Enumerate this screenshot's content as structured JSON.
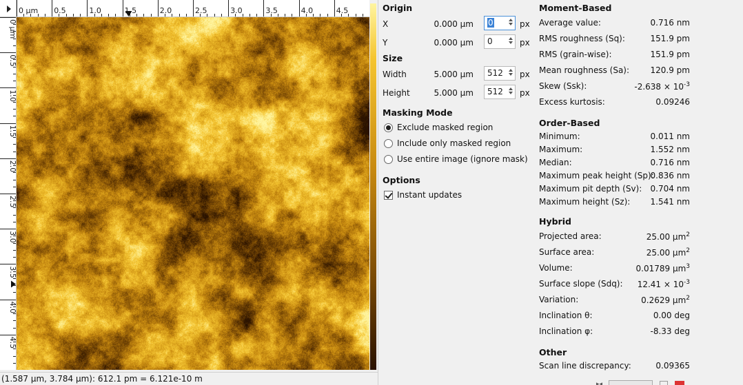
{
  "viewer": {
    "hruler_labels": [
      "0 µm",
      "0.5",
      "1.0",
      "1.5",
      "2.0",
      "2.5",
      "3.0",
      "3.5",
      "4.0",
      "4.5"
    ],
    "vruler_labels": [
      "0 µm",
      "0.5",
      "1.0",
      "1.5",
      "2.0",
      "2.5",
      "3.0",
      "3.5",
      "4.0",
      "4.5"
    ],
    "ruler_range_um": [
      0,
      5
    ],
    "cursor_um": {
      "x": 1.587,
      "y": 3.784
    },
    "status_text": "(1.587 µm, 3.784 µm): 612.1 pm = 6.121e-10 m",
    "colormap": [
      "#2a1200",
      "#7a4a05",
      "#c88a10",
      "#f5c530",
      "#fff5a0"
    ]
  },
  "origin": {
    "title": "Origin",
    "x_label": "X",
    "x_value": "0.000 µm",
    "x_px": "0",
    "x_unit": "px",
    "y_label": "Y",
    "y_value": "0.000 µm",
    "y_px": "0",
    "y_unit": "px"
  },
  "size": {
    "title": "Size",
    "width_label": "Width",
    "width_value": "5.000 µm",
    "width_px": "512",
    "width_unit": "px",
    "height_label": "Height",
    "height_value": "5.000 µm",
    "height_px": "512",
    "height_unit": "px"
  },
  "masking": {
    "title": "Masking Mode",
    "options": [
      {
        "label": "Exclude masked region",
        "selected": true
      },
      {
        "label": "Include only masked region",
        "selected": false
      },
      {
        "label": "Use entire image (ignore mask)",
        "selected": false
      }
    ]
  },
  "options": {
    "title": "Options",
    "instant_updates_label": "Instant updates",
    "instant_updates_checked": true
  },
  "moment": {
    "title": "Moment-Based",
    "rows": [
      {
        "label": "Average value:",
        "value": "0.716 nm"
      },
      {
        "label": "RMS roughness (Sq):",
        "value": "151.9 pm"
      },
      {
        "label": "RMS (grain-wise):",
        "value": "151.9 pm"
      },
      {
        "label": "Mean roughness (Sa):",
        "value": "120.9 pm"
      },
      {
        "label": "Skew (Ssk):",
        "value": "-2.638 × 10",
        "sup": "-3"
      },
      {
        "label": "Excess kurtosis:",
        "value": "0.09246"
      }
    ]
  },
  "order": {
    "title": "Order-Based",
    "rows": [
      {
        "label": "Minimum:",
        "value": "0.011 nm"
      },
      {
        "label": "Maximum:",
        "value": "1.552 nm"
      },
      {
        "label": "Median:",
        "value": "0.716 nm"
      },
      {
        "label": "Maximum peak height (Sp):",
        "value": "0.836 nm"
      },
      {
        "label": "Maximum pit depth (Sv):",
        "value": "0.704 nm"
      },
      {
        "label": "Maximum height (Sz):",
        "value": "1.541 nm"
      }
    ]
  },
  "hybrid": {
    "title": "Hybrid",
    "rows": [
      {
        "label": "Projected area:",
        "value": "25.00 µm",
        "sup": "2"
      },
      {
        "label": "Surface area:",
        "value": "25.00 µm",
        "sup": "2"
      },
      {
        "label": "Volume:",
        "value": "0.01789 µm",
        "sup": "3"
      },
      {
        "label": "Surface slope (Sdq):",
        "value": "12.41 × 10",
        "sup": "-3"
      },
      {
        "label": "Variation:",
        "value": "0.2629 µm",
        "sup": "2"
      },
      {
        "label": "Inclination θ:",
        "value": "0.00 deg"
      },
      {
        "label": "Inclination φ:",
        "value": "-8.33 deg"
      }
    ]
  },
  "other": {
    "title": "Other",
    "rows": [
      {
        "label": "Scan line discrepancy:",
        "value": "0.09365"
      }
    ]
  }
}
